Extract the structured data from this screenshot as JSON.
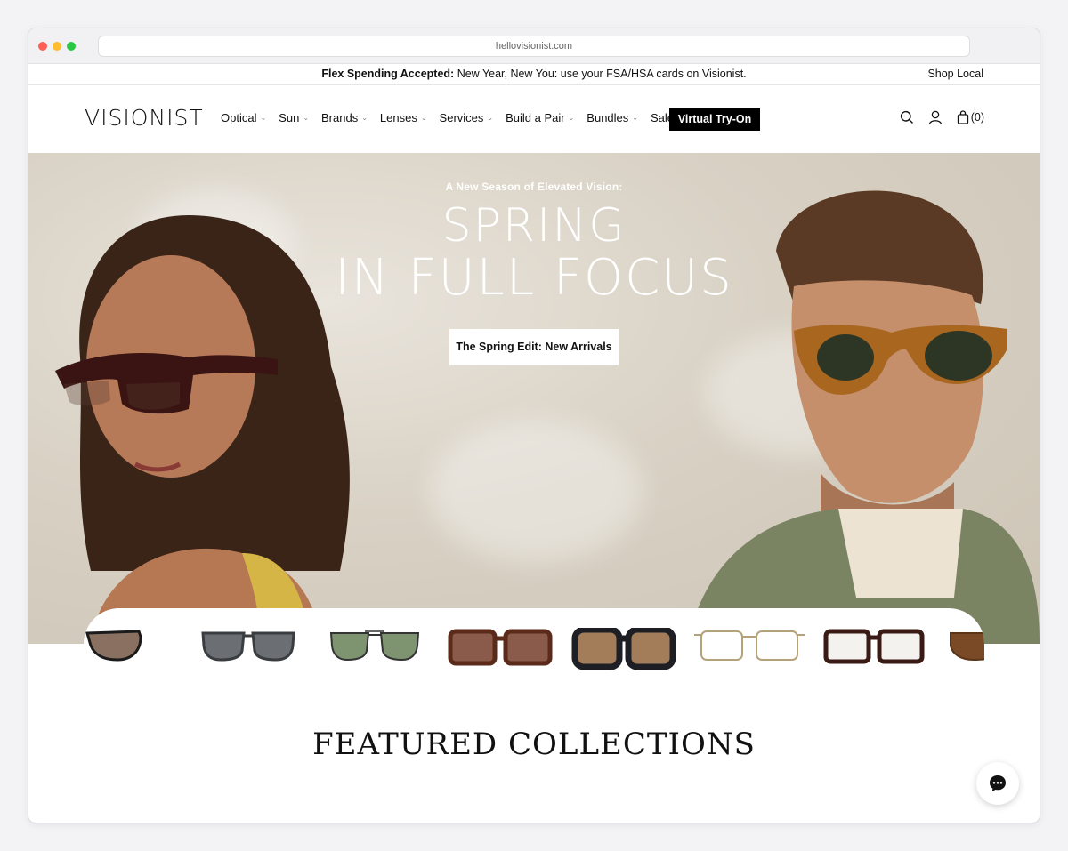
{
  "browser": {
    "url": "hellovisionist.com"
  },
  "announcement": {
    "bold": "Flex Spending Accepted:",
    "text": " New Year, New You: use your FSA/HSA cards on Visionist.",
    "right_link": "Shop Local"
  },
  "nav": {
    "logo": "VISIONIST",
    "items": [
      {
        "label": "Optical",
        "dropdown": true
      },
      {
        "label": "Sun",
        "dropdown": true
      },
      {
        "label": "Brands",
        "dropdown": true
      },
      {
        "label": "Lenses",
        "dropdown": true
      },
      {
        "label": "Services",
        "dropdown": true
      },
      {
        "label": "Build a Pair",
        "dropdown": true
      },
      {
        "label": "Bundles",
        "dropdown": true
      },
      {
        "label": "Sale",
        "dropdown": false
      }
    ],
    "tryon": "Virtual Try-On",
    "cart_count": "(0)"
  },
  "hero": {
    "eyebrow": "A New Season of Elevated Vision:",
    "line1": "SPRING",
    "line2": "IN FULL FOCUS",
    "cta": "The Spring Edit: New Arrivals"
  },
  "carousel": {
    "frames": [
      "cat-eye-sunglasses",
      "grey-wayfarer-sunglasses",
      "aviator-sunglasses",
      "tortoise-square-sunglasses",
      "black-oversized-sunglasses",
      "gold-wire-eyeglasses",
      "tortoise-eyeglasses",
      "brown-partial-sunglasses"
    ]
  },
  "featured": {
    "title": "FEATURED COLLECTIONS"
  },
  "colors": {
    "accent": "#000000",
    "hero_bg": "#d8d1c4"
  }
}
